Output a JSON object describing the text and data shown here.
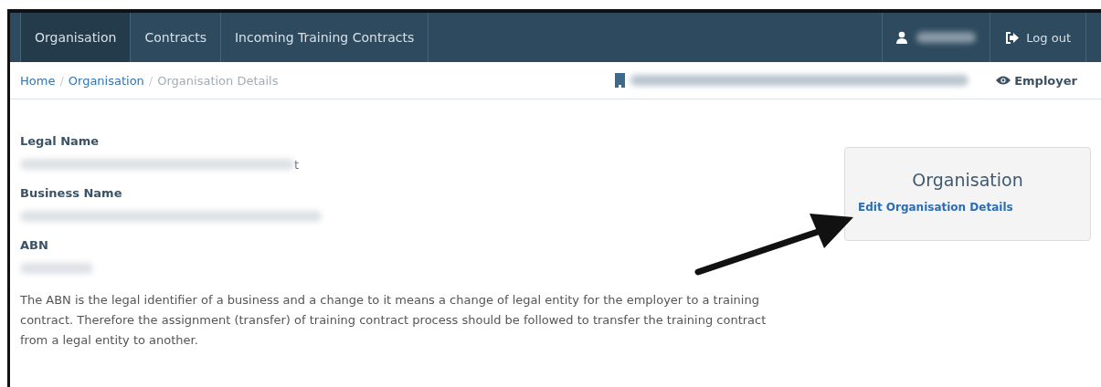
{
  "nav": {
    "tabs": [
      {
        "label": "Organisation",
        "selected": true
      },
      {
        "label": "Contracts",
        "selected": false
      },
      {
        "label": "Incoming Training Contracts",
        "selected": false
      }
    ],
    "logout": "Log out"
  },
  "breadcrumb": {
    "links": [
      {
        "label": "Home",
        "separator": "/"
      },
      {
        "label": "Organisation",
        "separator": "/"
      }
    ],
    "current": "Organisation Details",
    "role": "Employer"
  },
  "fields": [
    {
      "label": "Legal Name",
      "visible_tail": "t"
    },
    {
      "label": "Business Name"
    },
    {
      "label": "ABN"
    }
  ],
  "note": "The ABN is the legal identifier of a business and a change to it means a change of legal entity for the employer to a training contract. Therefore the assignment (transfer) of training contract process should be followed to transfer the training contract from a legal entity to another.",
  "card": {
    "title": "Organisation",
    "link": "Edit Organisation Details"
  }
}
